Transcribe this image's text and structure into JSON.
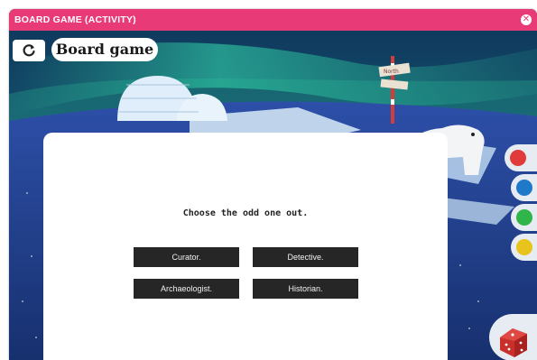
{
  "window": {
    "title": "BOARD GAME (ACTIVITY)",
    "close_icon": "✕"
  },
  "header": {
    "reload_icon": "reload-icon",
    "title": "Board game"
  },
  "scene": {
    "sign_text": "North"
  },
  "activity": {
    "question": "Choose the odd one out.",
    "options": [
      "Curator.",
      "Detective.",
      "Archaeologist.",
      "Historian."
    ]
  },
  "side_buttons": [
    {
      "name": "red",
      "color": "#e03a3a"
    },
    {
      "name": "blue",
      "color": "#1f78c8"
    },
    {
      "name": "green",
      "color": "#2fb54a"
    },
    {
      "name": "yellow",
      "color": "#e8c31c"
    }
  ],
  "colors": {
    "titlebar": "#e83a77",
    "option_bg": "#262626",
    "dice": "#c9302c"
  }
}
